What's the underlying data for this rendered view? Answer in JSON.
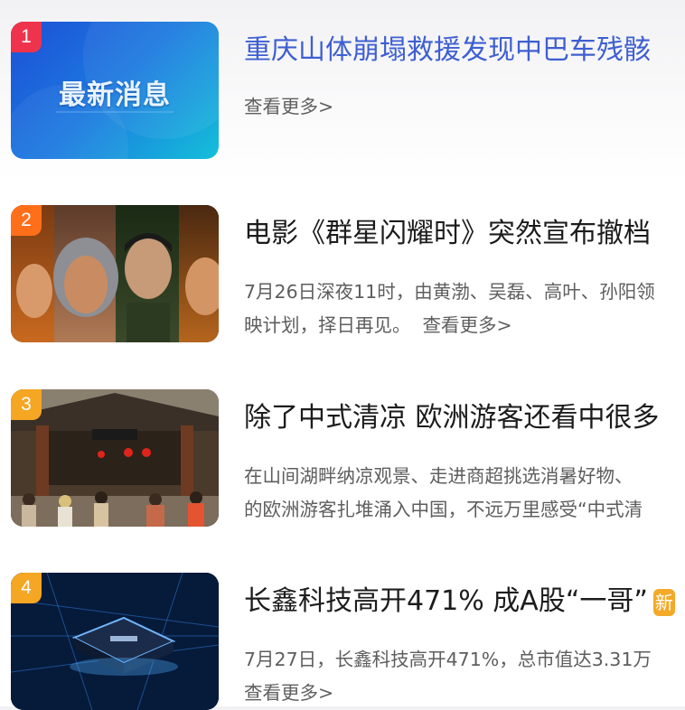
{
  "news": [
    {
      "rank": "1",
      "rank_color": "#f0334d",
      "title": "重庆山体崩塌救援发现中巴车残骸",
      "thumb_text": "最新消息",
      "desc_line1": "",
      "desc_line2": "",
      "more": "查看更多>"
    },
    {
      "rank": "2",
      "rank_color": "#ff6f1a",
      "title": "电影《群星闪耀时》突然宣布撤档",
      "desc_line1": "7月26日深夜11时，由黄渤、吴磊、高叶、孙阳领",
      "desc_line2": "映计划，择日再见。",
      "more": "查看更多>"
    },
    {
      "rank": "3",
      "rank_color": "#f5a623",
      "title": "除了中式清凉 欧洲游客还看中很多",
      "desc_line1": "在山间湖畔纳凉观景、走进商超挑选消暑好物、",
      "desc_line2": "的欧洲游客扎堆涌入中国，不远万里感受“中式清",
      "more": ""
    },
    {
      "rank": "4",
      "rank_color": "#f5a623",
      "title": "长鑫科技高开471% 成A股“一哥”",
      "badge": "新",
      "desc_line1": "7月27日，长鑫科技高开471%，总市值达3.31万",
      "desc_line2": "",
      "more": "查看更多>"
    }
  ]
}
